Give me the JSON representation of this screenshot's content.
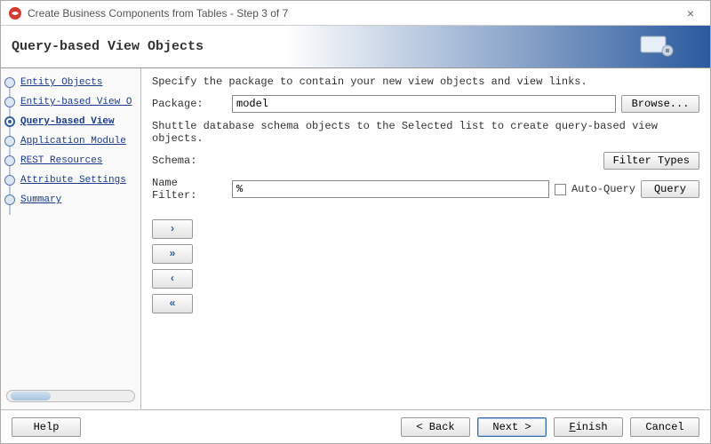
{
  "window": {
    "title": "Create Business Components from Tables - Step 3 of 7",
    "close_glyph": "×"
  },
  "banner": {
    "heading": "Query-based View Objects"
  },
  "steps": [
    {
      "label": "Entity Objects",
      "current": false
    },
    {
      "label": "Entity-based View O",
      "current": false
    },
    {
      "label": "Query-based View",
      "current": true
    },
    {
      "label": "Application Module",
      "current": false
    },
    {
      "label": "REST Resources",
      "current": false
    },
    {
      "label": "Attribute Settings",
      "current": false
    },
    {
      "label": "Summary",
      "current": false
    }
  ],
  "main": {
    "desc1": "Specify the package to contain your new view objects and view links.",
    "package_label": "Package:",
    "package_value": "model",
    "browse_label": "Browse...",
    "desc2": "Shuttle database schema objects to the Selected list to create query-based view objects.",
    "schema_label": "Schema:",
    "filter_types_label": "Filter Types",
    "name_filter_label": "Name Filter:",
    "name_filter_value": "%",
    "auto_query_label": "Auto-Query",
    "query_label": "Query"
  },
  "shuttle": {
    "add": "›",
    "addall": "»",
    "remove": "‹",
    "removeall": "«"
  },
  "footer": {
    "help": "Help",
    "back": "< Back",
    "next": "Next >",
    "finish": "Finish",
    "cancel": "Cancel"
  }
}
